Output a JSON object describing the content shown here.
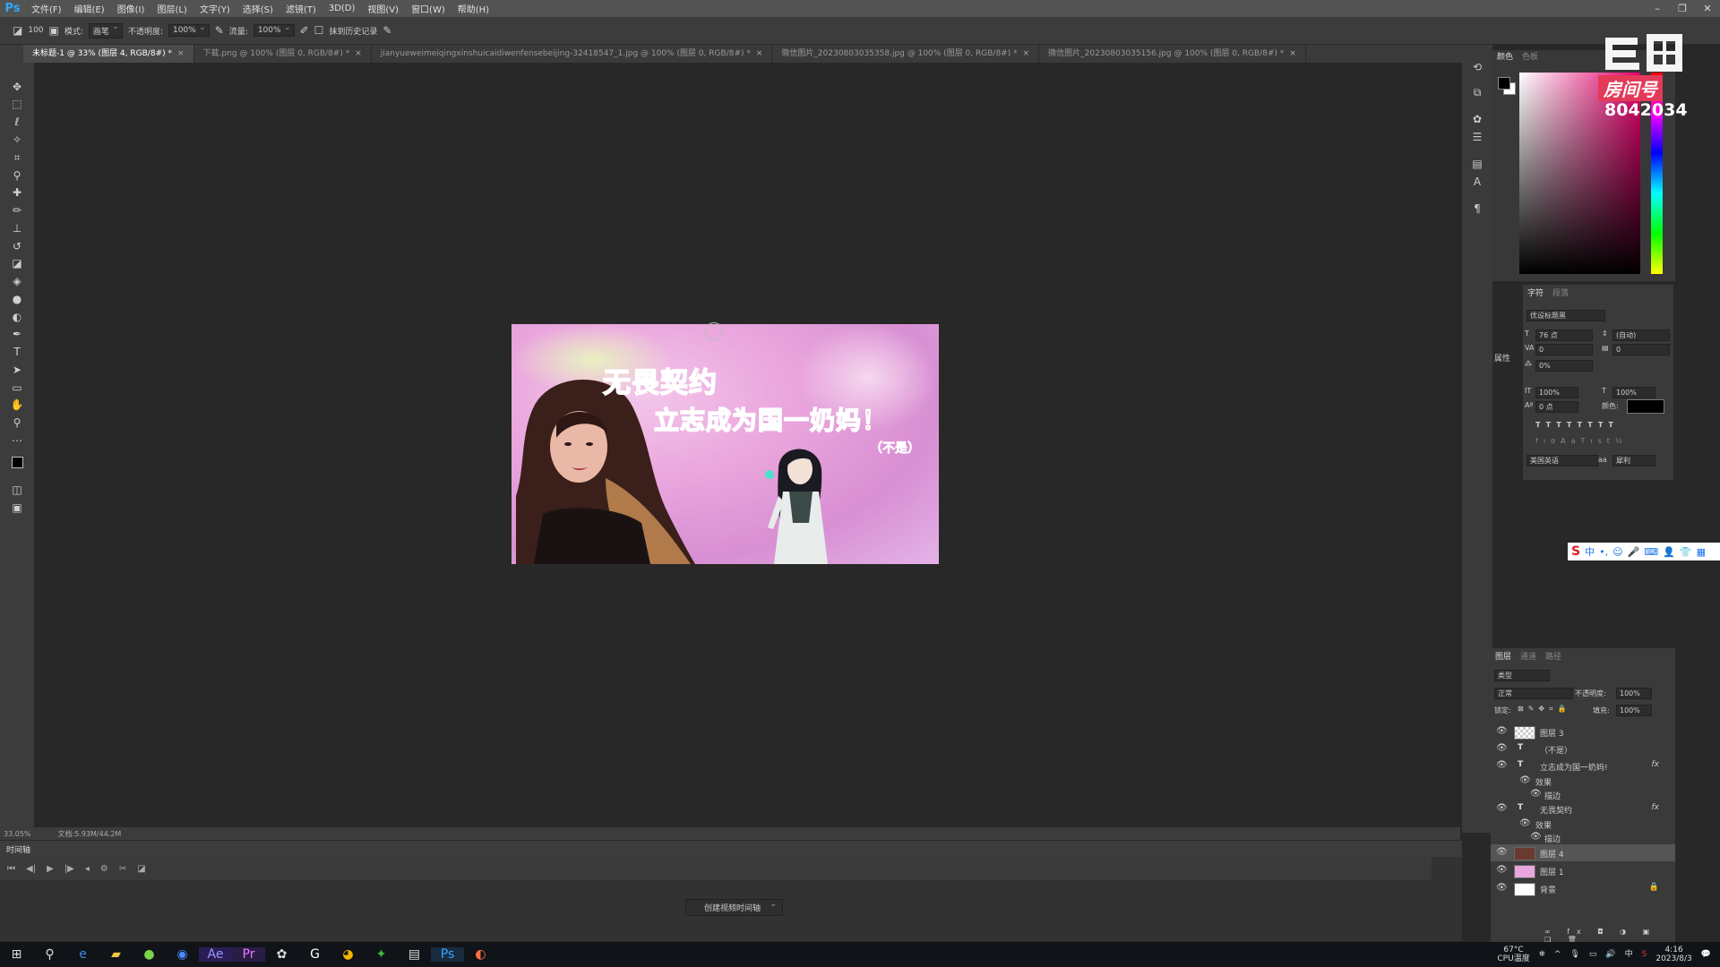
{
  "app": {
    "logo": "Ps"
  },
  "menu": [
    "文件(F)",
    "编辑(E)",
    "图像(I)",
    "图层(L)",
    "文字(Y)",
    "选择(S)",
    "滤镜(T)",
    "3D(D)",
    "视图(V)",
    "窗口(W)",
    "帮助(H)"
  ],
  "window_controls": [
    "–",
    "❐",
    "✕"
  ],
  "options": {
    "brush_size": "100",
    "mode_label": "模式:",
    "mode_value": "画笔",
    "opacity_label": "不透明度:",
    "opacity_value": "100%",
    "flow_label": "流量:",
    "flow_value": "100%",
    "history_label": "抹到历史记录"
  },
  "tabs": [
    {
      "label": "未标题-1 @ 33% (图层 4, RGB/8#) *",
      "active": true
    },
    {
      "label": "下载.png @ 100% (图层 0, RGB/8#) *",
      "active": false
    },
    {
      "label": "jianyueweimeiqingxinshuicaidiwenfensebeijing-32418547_1.jpg @ 100% (图层 0, RGB/8#) *",
      "active": false
    },
    {
      "label": "微信图片_20230803035358.jpg @ 100% (图层 0, RGB/8#) *",
      "active": false
    },
    {
      "label": "微信图片_20230803035156.jpg @ 100% (图层 0, RGB/8#) *",
      "active": false
    }
  ],
  "artwork": {
    "title1": "无畏契约",
    "title2": "立志成为国一奶妈！",
    "note": "（不是）"
  },
  "status": {
    "zoom": "33.05%",
    "doc": "文档:5.93M/44.2M"
  },
  "timeline": {
    "title": "时间轴",
    "create_button": "创建视频时间轴"
  },
  "color_panel": {
    "tabs": [
      "颜色",
      "色板"
    ],
    "room_label": "房间号",
    "room_number": "8042034"
  },
  "character_panel": {
    "tabs": [
      "字符",
      "段落"
    ],
    "font": "优设标题黑",
    "size": "76 点",
    "leading": "(自动)",
    "kerning": "0",
    "tracking": "0",
    "scale_pct": "0%",
    "vscale": "100%",
    "hscale": "100%",
    "baseline": "0 点",
    "color_label": "颜色:",
    "language": "美国英语",
    "aa": "犀利",
    "attr_label": "属性"
  },
  "layers_panel": {
    "tabs": [
      "图层",
      "通道",
      "路径"
    ],
    "filter": "类型",
    "blend": "正常",
    "opacity_label": "不透明度:",
    "opacity": "100%",
    "lock_label": "锁定:",
    "fill_label": "填充:",
    "fill": "100%",
    "layers": [
      {
        "name": "图层 3",
        "kind": "image",
        "thumb": "#ddd"
      },
      {
        "name": "（不是）",
        "kind": "text"
      },
      {
        "name": "立志成为国一奶妈!",
        "kind": "text",
        "fx": true
      },
      {
        "name": "效果",
        "kind": "sub"
      },
      {
        "name": "描边",
        "kind": "sub2"
      },
      {
        "name": "无畏契约",
        "kind": "text",
        "fx": true
      },
      {
        "name": "效果",
        "kind": "sub"
      },
      {
        "name": "描边",
        "kind": "sub2"
      },
      {
        "name": "图层 4",
        "kind": "image",
        "thumb": "#6b3a2e",
        "selected": true
      },
      {
        "name": "图层 1",
        "kind": "image",
        "thumb": "#e8a6dc"
      },
      {
        "name": "背景",
        "kind": "image",
        "thumb": "#ffffff",
        "locked": true
      }
    ]
  },
  "taskbar": {
    "temp": "67°C",
    "temp_label": "CPU温度",
    "time": "4:16",
    "date": "2023/8/3"
  }
}
